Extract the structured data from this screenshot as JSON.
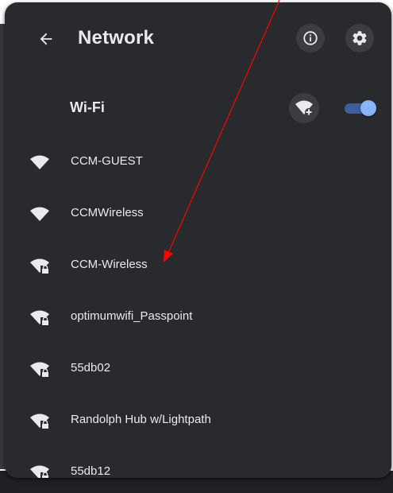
{
  "header": {
    "back_icon": "arrow-left-icon",
    "title": "Network",
    "info_icon": "info-icon",
    "settings_icon": "gear-icon"
  },
  "wifi": {
    "label": "Wi-Fi",
    "add_icon": "wifi-add-icon",
    "enabled": true,
    "toggle_color": "#8ab4f8"
  },
  "networks": [
    {
      "name": "CCM-GUEST",
      "secured": false,
      "icon": "wifi-icon"
    },
    {
      "name": "CCMWireless",
      "secured": false,
      "icon": "wifi-icon"
    },
    {
      "name": "CCM-Wireless",
      "secured": true,
      "icon": "wifi-lock-icon"
    },
    {
      "name": "optimumwifi_Passpoint",
      "secured": true,
      "icon": "wifi-lock-icon"
    },
    {
      "name": "55db02",
      "secured": true,
      "icon": "wifi-lock-icon"
    },
    {
      "name": "Randolph Hub w/Lightpath",
      "secured": true,
      "icon": "wifi-lock-icon"
    },
    {
      "name": "55db12",
      "secured": true,
      "icon": "wifi-lock-icon"
    }
  ],
  "colors": {
    "panel": "#292a2d",
    "text": "#e8eaed",
    "icon": "#e8eaed",
    "annotation_arrow": "#ff0000"
  }
}
